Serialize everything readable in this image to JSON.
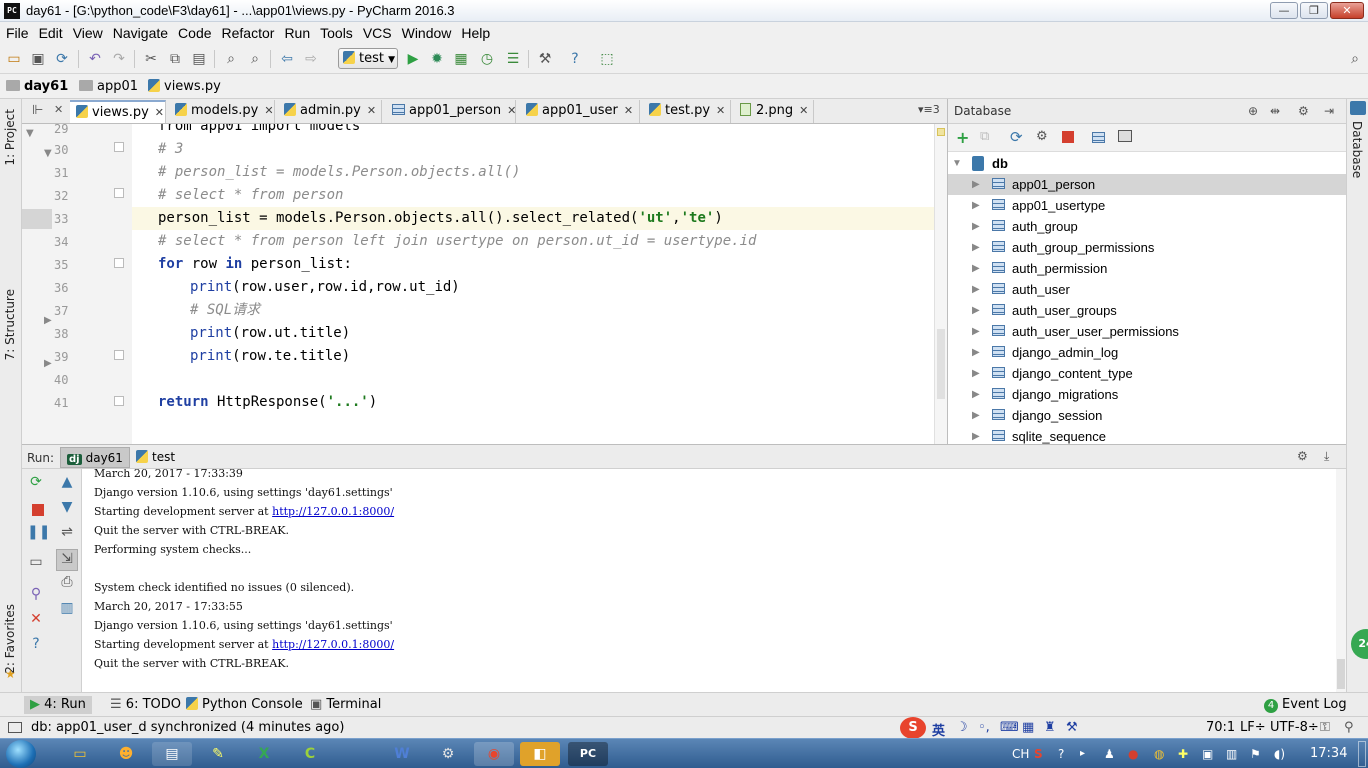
{
  "window": {
    "title": "day61 - [G:\\python_code\\F3\\day61] - ...\\app01\\views.py - PyCharm 2016.3",
    "app_icon": "PC",
    "controls": [
      "—",
      "❐",
      "✕"
    ]
  },
  "menu": [
    "File",
    "Edit",
    "View",
    "Navigate",
    "Code",
    "Refactor",
    "Run",
    "Tools",
    "VCS",
    "Window",
    "Help"
  ],
  "toolbar": {
    "run_config": "test"
  },
  "breadcrumb": [
    "day61",
    "app01",
    "views.py"
  ],
  "left_strip": {
    "project": "1: Project",
    "structure": "7: Structure",
    "favorites": "2: Favorites"
  },
  "right_strip": {
    "database": "Database"
  },
  "editor_tabs": [
    {
      "label": "views.py",
      "icon": "python-file-icon",
      "active": true
    },
    {
      "label": "models.py",
      "icon": "python-file-icon"
    },
    {
      "label": "admin.py",
      "icon": "python-file-icon"
    },
    {
      "label": "app01_person",
      "icon": "table-icon"
    },
    {
      "label": "app01_user",
      "icon": "python-file-icon"
    },
    {
      "label": "test.py",
      "icon": "python-file-icon"
    },
    {
      "label": "2.png",
      "icon": "image-icon"
    }
  ],
  "editor_tabs_overflow": "▾≡3",
  "code": {
    "line_numbers": [
      "29",
      "30",
      "31",
      "32",
      "33",
      "34",
      "35",
      "36",
      "37",
      "38",
      "39",
      "40",
      "41"
    ],
    "caret_line": "33",
    "lines": {
      "l29": "from app01 import models",
      "l30": "# 3",
      "l31": "# person_list = models.Person.objects.all()",
      "l32": "# select * from person",
      "l33a": "person_list = models.Person.objects.all().select_related(",
      "l33b": "'ut'",
      "l33c": ",",
      "l33d": "'te'",
      "l33e": ")",
      "l34": "# select * from person left join usertype on person.ut_id = usertype.id",
      "l35a": "for",
      "l35b": " row ",
      "l35c": "in",
      "l35d": " person_list:",
      "l36a": "print",
      "l36b": "(row.user,row.id,row.ut_id)",
      "l37": "# SQL请求",
      "l38a": "print",
      "l38b": "(row.ut.title)",
      "l39a": "print",
      "l39b": "(row.te.title)",
      "l41a": "return",
      "l41b": " HttpResponse(",
      "l41c": "'...'",
      "l41d": ")"
    }
  },
  "database": {
    "title": "Database",
    "root": "db",
    "tables": [
      "app01_person",
      "app01_usertype",
      "auth_group",
      "auth_group_permissions",
      "auth_permission",
      "auth_user",
      "auth_user_groups",
      "auth_user_user_permissions",
      "django_admin_log",
      "django_content_type",
      "django_migrations",
      "django_session",
      "sqlite_sequence"
    ],
    "selected": "app01_person"
  },
  "run": {
    "label": "Run:",
    "tabs": [
      {
        "label": "day61",
        "active": true
      },
      {
        "label": "test"
      }
    ],
    "console": [
      "March 20, 2017 - 17:33:39",
      "Django version 1.10.6, using settings 'day61.settings'",
      "Starting development server at ",
      "Quit the server with CTRL-BREAK.",
      "Performing system checks...",
      "",
      "System check identified no issues (0 silenced).",
      "March 20, 2017 - 17:33:55",
      "Django version 1.10.6, using settings 'day61.settings'",
      "Starting development server at ",
      "Quit the server with CTRL-BREAK."
    ],
    "server_url": "http://127.0.0.1:8000/"
  },
  "bottom_tabs": {
    "run": "4: Run",
    "todo": "6: TODO",
    "python_console": "Python Console",
    "terminal": "Terminal",
    "event_log_count": "4",
    "event_log": "Event Log"
  },
  "status": {
    "message": "db: app01_user_d synchronized (4 minutes ago)",
    "position": "70:1",
    "line_sep": "LF÷",
    "encoding": "UTF-8÷",
    "ime": "英"
  },
  "taskbar": {
    "lang": "CH",
    "clock": "17:34",
    "badge": "24"
  },
  "colors": {
    "accent": "#3c78aa",
    "run_green": "#2ea043",
    "stop_red": "#d43f2f"
  }
}
